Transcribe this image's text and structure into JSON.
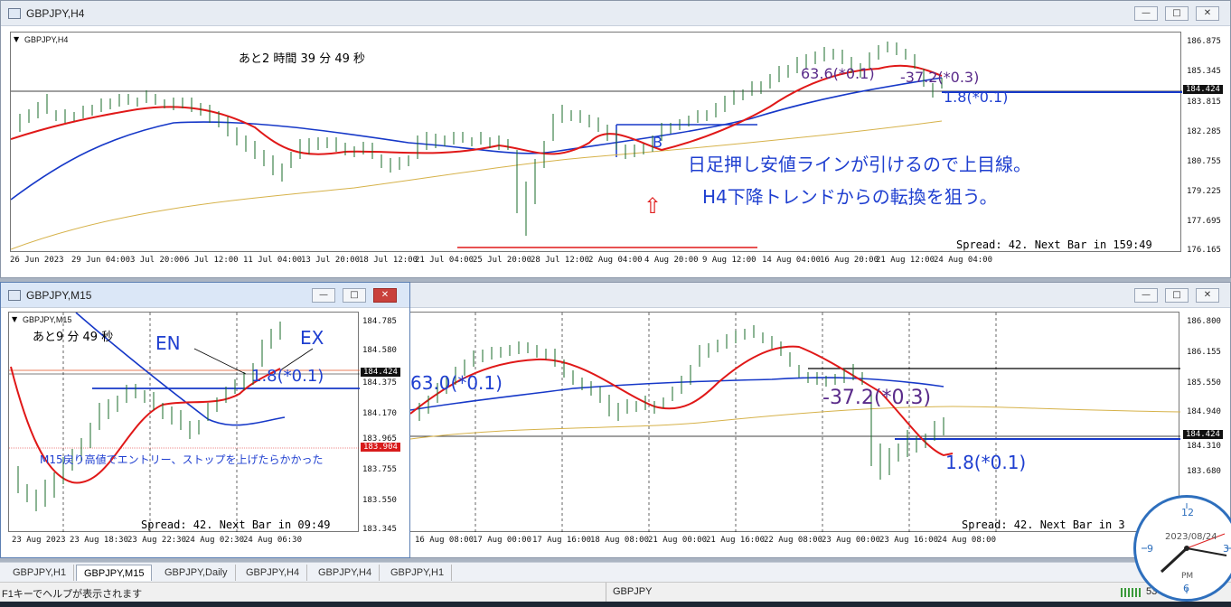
{
  "windows": {
    "top": {
      "title": "GBPJPY,H4",
      "symbol_label": "GBPJPY,H4",
      "countdown": "あと2 時間 39 分 49 秒",
      "spread_text": "Spread: 42. Next Bar in 159:49",
      "price_ticks": [
        "186.875",
        "185.345",
        "183.815",
        "182.285",
        "180.755",
        "179.225",
        "177.695",
        "176.165"
      ],
      "current_price": "184.424",
      "time_ticks": [
        "26 Jun 2023",
        "29 Jun 04:00",
        "3 Jul 20:00",
        "6 Jul 12:00",
        "11 Jul 04:00",
        "13 Jul 20:00",
        "18 Jul 12:00",
        "21 Jul 04:00",
        "25 Jul 20:00",
        "28 Jul 12:00",
        "2 Aug 04:00",
        "4 Aug 20:00",
        "9 Aug 12:00",
        "14 Aug 04:00",
        "16 Aug 20:00",
        "21 Aug 12:00",
        "24 Aug 04:00"
      ],
      "annotation_line1": "日足押し安値ラインが引けるので上目線。",
      "annotation_line2": "H4下降トレンドからの転換を狙う。",
      "arrow": "⇧",
      "label_up": "63.6(*0.1)",
      "label_minus": "-37.2(*0.3)",
      "label_small": "1.8(*0.1)",
      "label_b": "B"
    },
    "m15": {
      "title": "GBPJPY,M15",
      "symbol_label": "GBPJPY,M15",
      "countdown": "あと9 分 49 秒",
      "spread_text": "Spread: 42. Next Bar in 09:49",
      "price_ticks": [
        "184.785",
        "184.580",
        "184.375",
        "184.170",
        "183.965",
        "183.755",
        "183.550",
        "183.345"
      ],
      "current_price": "184.424",
      "low_price_tag": "183.904",
      "time_ticks": [
        "23 Aug 2023",
        "23 Aug 18:30",
        "23 Aug 22:30",
        "24 Aug 02:30",
        "24 Aug 06:30"
      ],
      "label_en": "EN",
      "label_ex": "EX",
      "label_pips": "1.8(*0.1)",
      "note": "M15戻り高値でエントリー、ストップを上げたらかかった"
    },
    "bottom": {
      "spread_text": "Spread: 42. Next Bar in 3",
      "price_ticks": [
        "186.800",
        "186.155",
        "185.550",
        "184.940",
        "184.310",
        "183.680"
      ],
      "current_price": "184.424",
      "time_ticks": [
        "16 Aug 08:00",
        "17 Aug 00:00",
        "17 Aug 16:00",
        "18 Aug 08:00",
        "21 Aug 00:00",
        "21 Aug 16:00",
        "22 Aug 08:00",
        "23 Aug 00:00",
        "23 Aug 16:00",
        "24 Aug 08:00"
      ],
      "label_left": "63.0(*0.1)",
      "label_minus": "-37.2(*0.3)",
      "label_small": "1.8(*0.1)"
    }
  },
  "tabs": [
    "GBPJPY,H1",
    "GBPJPY,M15",
    "GBPJPY,Daily",
    "GBPJPY,H4",
    "GBPJPY,H4",
    "GBPJPY,H1"
  ],
  "active_tab": 1,
  "status": {
    "help": "F1キーでヘルプが表示されます",
    "symbol": "GBPJPY",
    "right": "53"
  },
  "clock": {
    "date": "2023/08/24",
    "pm": "PM"
  },
  "window_buttons": {
    "minimize": "—",
    "maximize": "□",
    "close": "✕"
  },
  "colors": {
    "candle": "#1a6b2a",
    "ma_red": "#e01818",
    "ma_blue": "#1638c8",
    "ma_gold": "#d6b24a",
    "annotation_blue": "#1f3fd0",
    "purple": "#5a2b8a",
    "arrow_red": "#e02020"
  }
}
